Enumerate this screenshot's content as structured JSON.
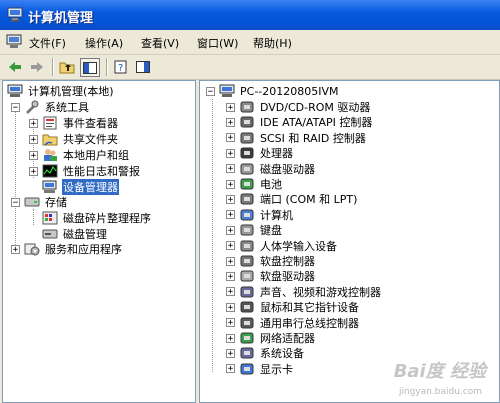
{
  "window": {
    "title": "计算机管理"
  },
  "menu": [
    "文件(F)",
    "操作(A)",
    "查看(V)",
    "窗口(W)",
    "帮助(H)"
  ],
  "toolbar": {
    "icons": [
      "back-icon",
      "forward-icon",
      "up-icon",
      "show-tree-icon",
      "properties-icon",
      "help-icon"
    ]
  },
  "tree": {
    "root": "计算机管理(本地)",
    "system_tools": "系统工具",
    "event_viewer": "事件查看器",
    "shared_folders": "共享文件夹",
    "local_users": "本地用户和组",
    "perf_logs": "性能日志和警报",
    "device_manager": "设备管理器",
    "storage": "存储",
    "defrag": "磁盘碎片整理程序",
    "disk_mgmt": "磁盘管理",
    "services": "服务和应用程序"
  },
  "devices": {
    "computer_name": "PC--20120805IVM",
    "items": [
      "DVD/CD-ROM 驱动器",
      "IDE ATA/ATAPI 控制器",
      "SCSI 和 RAID 控制器",
      "处理器",
      "磁盘驱动器",
      "电池",
      "端口 (COM 和 LPT)",
      "计算机",
      "键盘",
      "人体学输入设备",
      "软盘控制器",
      "软盘驱动器",
      "声音、视频和游戏控制器",
      "鼠标和其它指针设备",
      "通用串行总线控制器",
      "网络适配器",
      "系统设备",
      "显示卡"
    ]
  },
  "watermark": {
    "brand": "Bai度 经验",
    "url": "jingyan.baidu.com"
  }
}
